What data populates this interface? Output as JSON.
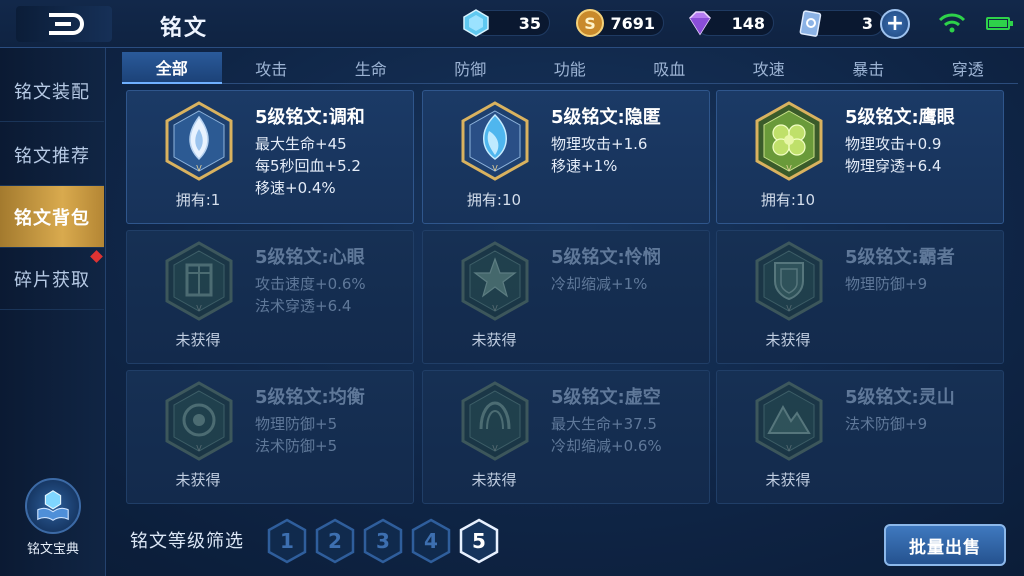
{
  "header": {
    "title": "铭文",
    "resources": [
      {
        "icon": "diamond-crystal-icon",
        "value": "35"
      },
      {
        "icon": "gold-coin-icon",
        "value": "7691"
      },
      {
        "icon": "purple-gem-icon",
        "value": "148"
      },
      {
        "icon": "coupon-card-icon",
        "value": "3"
      }
    ]
  },
  "sidebar": {
    "items": [
      {
        "label": "铭文装配",
        "active": false
      },
      {
        "label": "铭文推荐",
        "active": false
      },
      {
        "label": "铭文背包",
        "active": true
      },
      {
        "label": "碎片获取",
        "active": false
      }
    ],
    "codex_label": "铭文宝典"
  },
  "tabs": [
    "全部",
    "攻击",
    "生命",
    "防御",
    "功能",
    "吸血",
    "攻速",
    "暴击",
    "穿透"
  ],
  "active_tab": "全部",
  "cards": [
    {
      "name": "5级铭文:调和",
      "attrs": [
        "最大生命+45",
        "每5秒回血+5.2",
        "移速+0.4%"
      ],
      "owned": "拥有:1",
      "locked": false,
      "emblem": "white-flame-emblem-icon"
    },
    {
      "name": "5级铭文:隐匿",
      "attrs": [
        "物理攻击+1.6",
        "移速+1%"
      ],
      "owned": "拥有:10",
      "locked": false,
      "emblem": "blue-flame-emblem-icon"
    },
    {
      "name": "5级铭文:鹰眼",
      "attrs": [
        "物理攻击+0.9",
        "物理穿透+6.4"
      ],
      "owned": "拥有:10",
      "locked": false,
      "emblem": "green-clover-emblem-icon"
    },
    {
      "name": "5级铭文:心眼",
      "attrs": [
        "攻击速度+0.6%",
        "法术穿透+6.4"
      ],
      "owned": "未获得",
      "locked": true,
      "emblem": "gate-emblem-icon"
    },
    {
      "name": "5级铭文:怜悯",
      "attrs": [
        "冷却缩减+1%"
      ],
      "owned": "未获得",
      "locked": true,
      "emblem": "star-emblem-icon"
    },
    {
      "name": "5级铭文:霸者",
      "attrs": [
        "物理防御+9"
      ],
      "owned": "未获得",
      "locked": true,
      "emblem": "shield-emblem-icon"
    },
    {
      "name": "5级铭文:均衡",
      "attrs": [
        "物理防御+5",
        "法术防御+5"
      ],
      "owned": "未获得",
      "locked": true,
      "emblem": "circle-emblem-icon"
    },
    {
      "name": "5级铭文:虚空",
      "attrs": [
        "最大生命+37.5",
        "冷却缩减+0.6%"
      ],
      "owned": "未获得",
      "locked": true,
      "emblem": "void-emblem-icon"
    },
    {
      "name": "5级铭文:灵山",
      "attrs": [
        "法术防御+9"
      ],
      "owned": "未获得",
      "locked": true,
      "emblem": "mountain-emblem-icon"
    }
  ],
  "filter": {
    "label": "铭文等级筛选",
    "levels": [
      "1",
      "2",
      "3",
      "4",
      "5"
    ],
    "active_level": "5"
  },
  "sell_button": "批量出售",
  "colors": {
    "accent_gold": "#d9aa4e",
    "accent_blue": "#2a5a9a",
    "battery_green": "#2ed24a"
  }
}
